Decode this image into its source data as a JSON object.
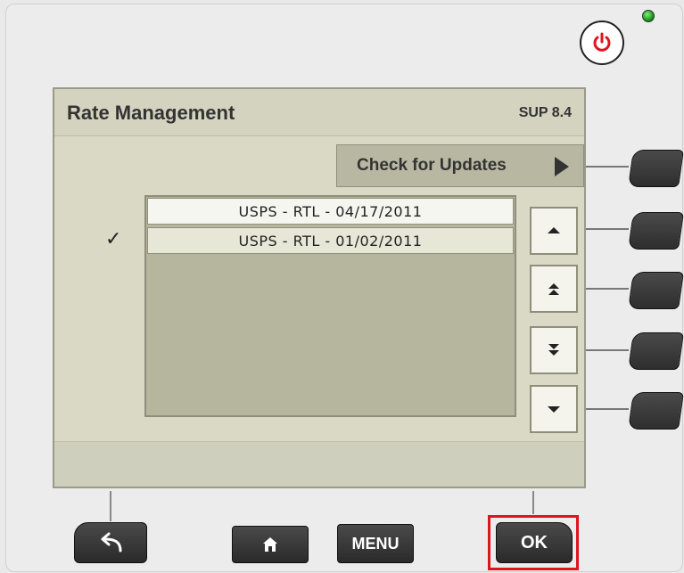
{
  "screen": {
    "title": "Rate Management",
    "version": "SUP 8.4"
  },
  "check_updates": {
    "label": "Check for Updates",
    "icon": "play-arrow-icon"
  },
  "rates": {
    "items": [
      {
        "label": "USPS - RTL - 04/17/2011",
        "selected": false
      },
      {
        "label": "USPS - RTL - 01/02/2011",
        "selected": true
      }
    ],
    "selected_mark": "✓"
  },
  "scroll_buttons": [
    {
      "name": "scroll-up-button",
      "icon": "chevron-up-icon"
    },
    {
      "name": "page-up-button",
      "icon": "double-chevron-up-icon"
    },
    {
      "name": "page-down-button",
      "icon": "double-chevron-down-icon"
    },
    {
      "name": "scroll-down-button",
      "icon": "chevron-down-icon"
    }
  ],
  "keys": {
    "back_icon": "back-arrow-icon",
    "home_icon": "home-icon",
    "menu_label": "MENU",
    "ok_label": "OK"
  },
  "colors": {
    "highlight": "#e0141e",
    "power": "#e0141e",
    "led": "#14b814"
  }
}
